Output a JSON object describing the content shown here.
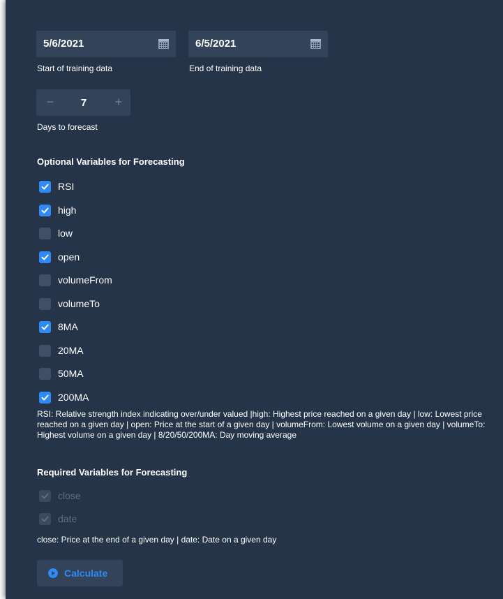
{
  "training": {
    "start_date": "5/6/2021",
    "start_caption": "Start of training data",
    "end_date": "6/5/2021",
    "end_caption": "End of training data"
  },
  "forecast": {
    "days": "7",
    "minus": "−",
    "plus": "+",
    "caption": "Days to forecast"
  },
  "optional": {
    "title": "Optional Variables for Forecasting",
    "items": [
      {
        "label": "RSI",
        "checked": true
      },
      {
        "label": "high",
        "checked": true
      },
      {
        "label": "low",
        "checked": false
      },
      {
        "label": "open",
        "checked": true
      },
      {
        "label": "volumeFrom",
        "checked": false
      },
      {
        "label": "volumeTo",
        "checked": false
      },
      {
        "label": "8MA",
        "checked": true
      },
      {
        "label": "20MA",
        "checked": false
      },
      {
        "label": "50MA",
        "checked": false
      },
      {
        "label": "200MA",
        "checked": true
      }
    ],
    "description": "RSI: Relative strength index indicating over/under valued |high: Highest price reached on a given day | low: Lowest price reached on a given day | open: Price at the start of a given day | volumeFrom: Lowest volume on a given day | volumeTo: Highest volume on a given day | 8/20/50/200MA: Day moving average"
  },
  "required": {
    "title": "Required Variables for Forecasting",
    "items": [
      {
        "label": "close",
        "checked": true,
        "disabled": true
      },
      {
        "label": "date",
        "checked": true,
        "disabled": true
      }
    ],
    "description": "close: Price at the end of a given day | date: Date on a given day"
  },
  "actions": {
    "calculate_label": "Calculate",
    "calculate_icon": "play-circle-icon"
  },
  "colors": {
    "panel_bg": "#253448",
    "input_bg": "#32435a",
    "accent": "#2f8af5"
  }
}
